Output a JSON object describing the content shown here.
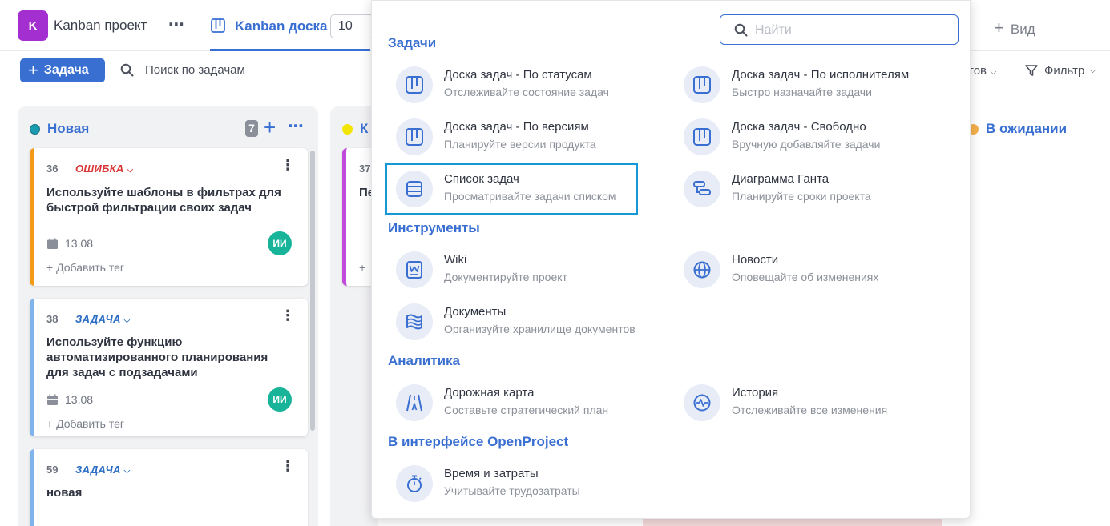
{
  "topbar": {
    "project_initial": "K",
    "project_name": "Kanban проект",
    "more_icon": "⋯",
    "board_title": "Kanban доска",
    "page_size": "10",
    "view_label": "Вид"
  },
  "toolbar": {
    "add_task_label": "Задача",
    "search_label": "Поиск по задачам",
    "right_partial": "тов",
    "filter_label": "Фильтр"
  },
  "columns": [
    {
      "name": "Новая",
      "dot_color": "#1a9bb0",
      "count": "7",
      "cards": [
        {
          "num": "36",
          "type": "ОШИБКА",
          "type_color": "#d93737",
          "border": "#f39b17",
          "title": "Используйте шаблоны в фильтрах для быстрой фильтрации своих задач",
          "date": "13.08",
          "avatar": "ИИ",
          "tag": "+ Добавить тег"
        },
        {
          "num": "38",
          "type": "ЗАДАЧА",
          "type_color": "#2a6cc4",
          "border": "#7fb5ea",
          "title": "Используйте функцию автоматизированного планирования для задач с подзадачами",
          "date": "13.08",
          "avatar": "ИИ",
          "tag": "+ Добавить тег"
        },
        {
          "num": "59",
          "type": "ЗАДАЧА",
          "type_color": "#2a6cc4",
          "border": "#7fb5ea",
          "title": "новая"
        }
      ]
    },
    {
      "name": "К",
      "dot_color": "#f2e600",
      "cards": [
        {
          "num": "37",
          "title": "Пе",
          "tag": "+"
        }
      ]
    },
    {
      "name": "В ожидании",
      "dot_color": "#f5b04d"
    }
  ],
  "dropdown": {
    "search_placeholder": "Найти",
    "sections": [
      {
        "title": "Задачи",
        "items": [
          {
            "title": "Доска задач - По статусам",
            "desc": "Отслеживайте состояние задач",
            "icon": "board-icon"
          },
          {
            "title": "Доска задач - По исполнителям",
            "desc": "Быстро назначайте задачи",
            "icon": "board-icon"
          },
          {
            "title": "Доска задач - По версиям",
            "desc": "Планируйте версии продукта",
            "icon": "board-icon"
          },
          {
            "title": "Доска задач - Свободно",
            "desc": "Вручную добавляйте задачи",
            "icon": "board-icon"
          },
          {
            "title": "Список задач",
            "desc": "Просматривайте задачи списком",
            "icon": "list-icon",
            "highlighted": true
          },
          {
            "title": "Диаграмма Ганта",
            "desc": "Планируйте сроки проекта",
            "icon": "gantt-icon"
          }
        ]
      },
      {
        "title": "Инструменты",
        "items": [
          {
            "title": "Wiki",
            "desc": "Документируйте проект",
            "icon": "wiki-icon"
          },
          {
            "title": "Новости",
            "desc": "Оповещайте об изменениях",
            "icon": "globe-icon"
          },
          {
            "title": "Документы",
            "desc": "Организуйте хранилище документов",
            "icon": "documents-icon"
          }
        ]
      },
      {
        "title": "Аналитика",
        "items": [
          {
            "title": "Дорожная карта",
            "desc": "Составьте стратегический план",
            "icon": "roadmap-icon"
          },
          {
            "title": "История",
            "desc": "Отслеживайте все изменения",
            "icon": "activity-icon"
          }
        ]
      },
      {
        "title": "В интерфейсе OpenProject",
        "items": [
          {
            "title": "Время и затраты",
            "desc": "Учитывайте трудозатраты",
            "icon": "stopwatch-icon"
          }
        ]
      }
    ]
  }
}
